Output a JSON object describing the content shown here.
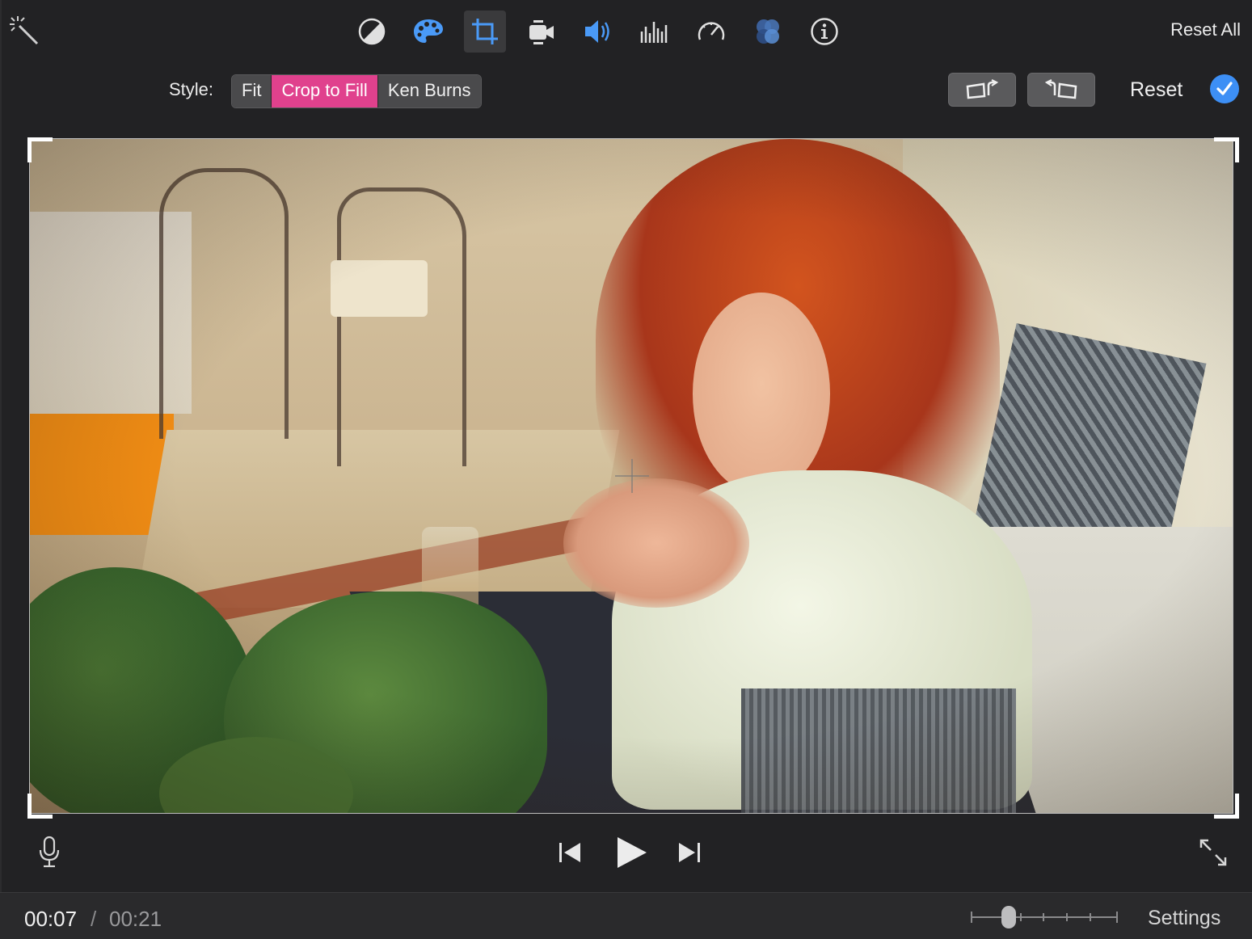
{
  "toolbar": {
    "tools": [
      {
        "name": "color-balance",
        "icon": "color-balance-icon"
      },
      {
        "name": "color-correction",
        "icon": "palette-icon"
      },
      {
        "name": "cropping",
        "icon": "crop-icon",
        "active": true
      },
      {
        "name": "stabilization",
        "icon": "video-camera-icon"
      },
      {
        "name": "volume",
        "icon": "speaker-icon"
      },
      {
        "name": "noise-reduction",
        "icon": "equalizer-icon"
      },
      {
        "name": "speed",
        "icon": "speedometer-icon"
      },
      {
        "name": "clip-filter",
        "icon": "filter-circles-icon"
      },
      {
        "name": "clip-info",
        "icon": "info-icon"
      }
    ],
    "reset_all_label": "Reset All"
  },
  "style_row": {
    "label": "Style:",
    "options": [
      "Fit",
      "Crop to Fill",
      "Ken Burns"
    ],
    "selected": "Crop to Fill",
    "reset_label": "Reset"
  },
  "playback": {
    "current_time": "00:07",
    "separator": "/",
    "total_time": "00:21"
  },
  "footer": {
    "settings_label": "Settings",
    "zoom_level": 0.2
  },
  "colors": {
    "accent_selected": "#e0418d",
    "active_icon_blue": "#3d8ff5",
    "background": "#222224"
  }
}
